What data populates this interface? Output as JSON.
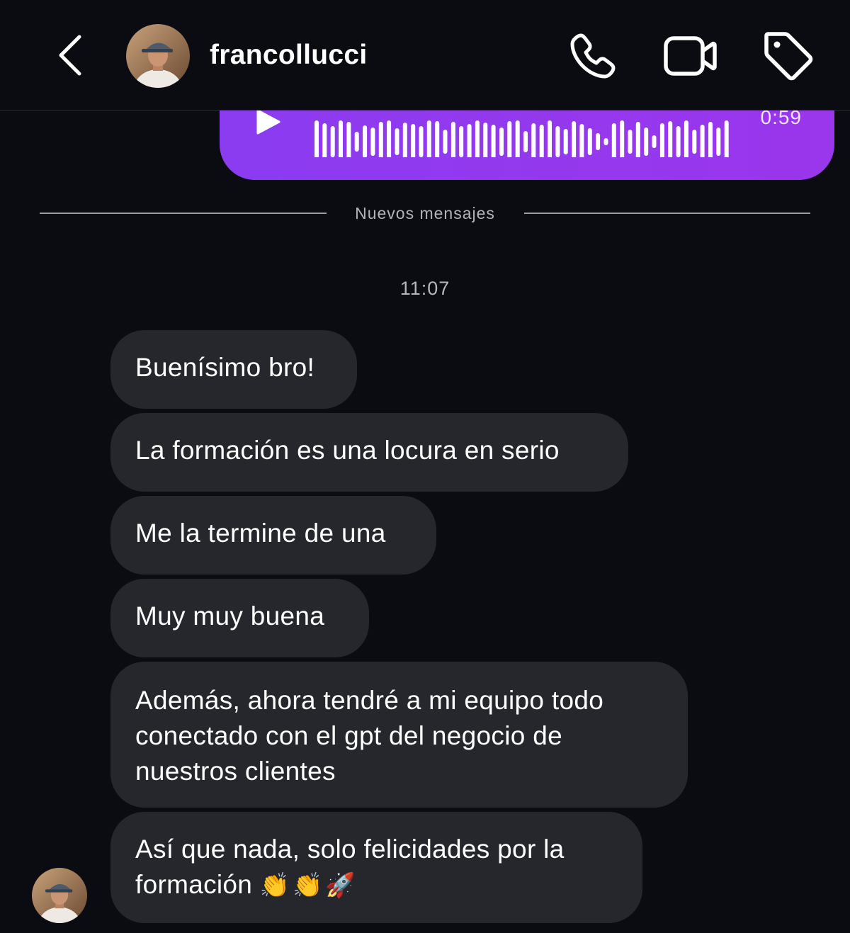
{
  "header": {
    "username": "francollucci",
    "icons": {
      "back": "chevron-left-icon",
      "call": "phone-icon",
      "video": "video-camera-icon",
      "tag": "tag-icon"
    }
  },
  "voice_note": {
    "duration": "0:59",
    "color": "#9538ee"
  },
  "divider": {
    "label": "Nuevos mensajes"
  },
  "timestamp": "11:07",
  "messages": [
    {
      "text": "Buenísimo bro!"
    },
    {
      "text": "La formación es una locura en serio"
    },
    {
      "text": "Me la termine de una"
    },
    {
      "text": "Muy muy buena"
    },
    {
      "line1": "Además, ahora tendré a mi equipo todo",
      "line2": "conectado con el gpt del negocio de",
      "line3": "nuestros clientes"
    },
    {
      "line1": "Así que nada, solo felicidades por la",
      "line2": "formación",
      "emoji": "👏👏🚀"
    }
  ]
}
